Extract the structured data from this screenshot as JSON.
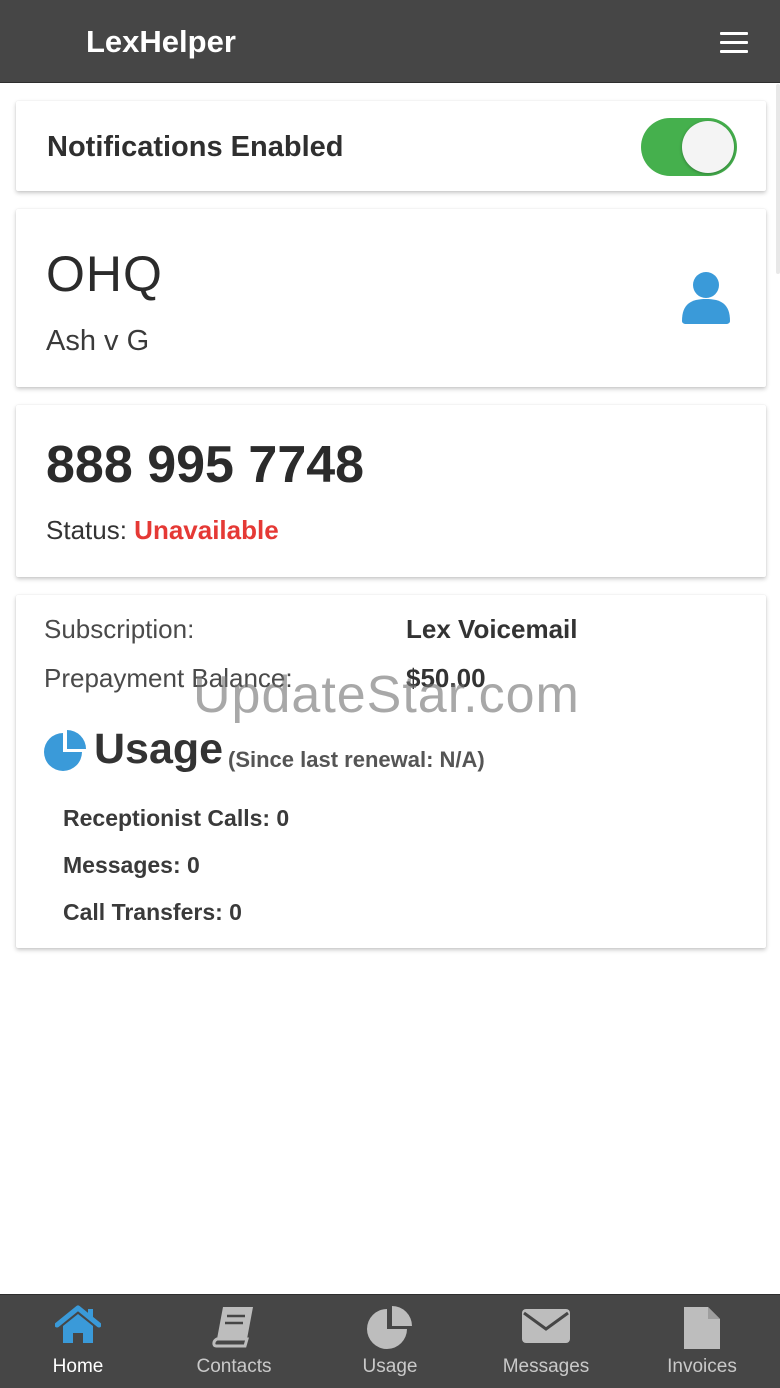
{
  "app": {
    "title": "LexHelper"
  },
  "notifications": {
    "label": "Notifications Enabled",
    "enabled": true
  },
  "account": {
    "name": "OHQ",
    "case": "Ash v G"
  },
  "phone": {
    "number": "888 995 7748",
    "status_label": "Status:",
    "status_value": "Unavailable",
    "status_color": "#e53935"
  },
  "details": {
    "subscription_label": "Subscription:",
    "subscription_value": "Lex Voicemail",
    "balance_label": "Prepayment Balance:",
    "balance_value": "$50.00"
  },
  "usage": {
    "title": "Usage",
    "since": "(Since last renewal: N/A)",
    "items": [
      {
        "label": "Receptionist Calls: 0"
      },
      {
        "label": "Messages: 0"
      },
      {
        "label": "Call Transfers: 0"
      }
    ]
  },
  "watermark": "UpdateStar.com",
  "nav": {
    "items": [
      {
        "label": "Home",
        "icon": "home-icon",
        "active": true
      },
      {
        "label": "Contacts",
        "icon": "book-icon",
        "active": false
      },
      {
        "label": "Usage",
        "icon": "pie-chart-icon",
        "active": false
      },
      {
        "label": "Messages",
        "icon": "envelope-icon",
        "active": false
      },
      {
        "label": "Invoices",
        "icon": "file-icon",
        "active": false
      }
    ]
  },
  "colors": {
    "header_bg": "#464646",
    "accent_blue": "#3a9ad9",
    "toggle_green": "#45b04d",
    "status_red": "#e53935",
    "nav_inactive": "#c9c9c9"
  }
}
